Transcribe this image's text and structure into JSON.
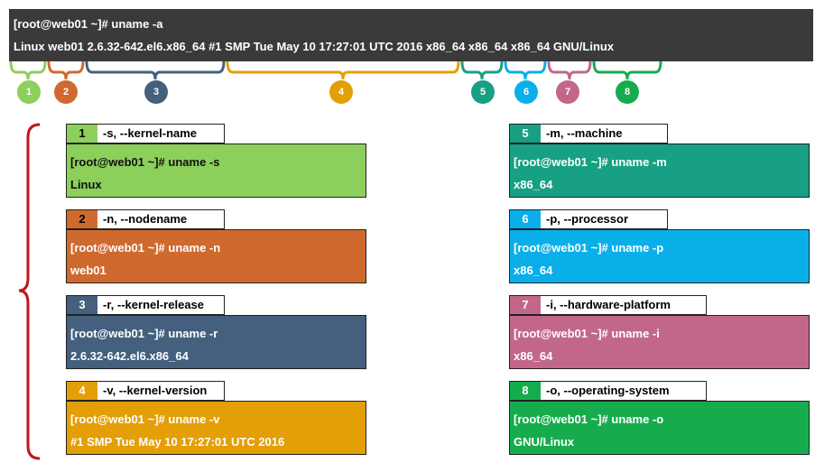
{
  "terminal": {
    "command": "[root@web01 ~]# uname -a",
    "output": "Linux web01 2.6.32-642.el6.x86_64 #1 SMP Tue May 10 17:27:01 UTC 2016 x86_64 x86_64 x86_64 GNU/Linux"
  },
  "colors": {
    "c1": "#8ccf5a",
    "c2": "#d0692e",
    "c3": "#44607e",
    "c4": "#e49e06",
    "c5": "#17a084",
    "c6": "#0aafe9",
    "c7": "#c2678a",
    "c8": "#16ac4e",
    "brace_left": "#c0161c"
  },
  "callouts": [
    "1",
    "2",
    "3",
    "4",
    "5",
    "6",
    "7",
    "8"
  ],
  "options": [
    {
      "num": "1",
      "option": "-s, --kernel-name",
      "command": "[root@web01 ~]# uname -s",
      "output": "Linux"
    },
    {
      "num": "2",
      "option": "-n, --nodename",
      "command": "[root@web01 ~]# uname -n",
      "output": "web01"
    },
    {
      "num": "3",
      "option": "-r, --kernel-release",
      "command": "[root@web01 ~]# uname -r",
      "output": "2.6.32-642.el6.x86_64"
    },
    {
      "num": "4",
      "option": "-v, --kernel-version",
      "command": "[root@web01 ~]# uname -v",
      "output": "#1 SMP Tue May 10 17:27:01 UTC 2016"
    },
    {
      "num": "5",
      "option": "-m, --machine",
      "command": "[root@web01 ~]# uname -m",
      "output": "x86_64"
    },
    {
      "num": "6",
      "option": "-p, --processor",
      "command": "[root@web01 ~]# uname -p",
      "output": "x86_64"
    },
    {
      "num": "7",
      "option": "-i, --hardware-platform",
      "command": "[root@web01 ~]# uname -i",
      "output": "x86_64"
    },
    {
      "num": "8",
      "option": "-o, --operating-system",
      "command": "[root@web01 ~]# uname -o",
      "output": "GNU/Linux"
    }
  ]
}
